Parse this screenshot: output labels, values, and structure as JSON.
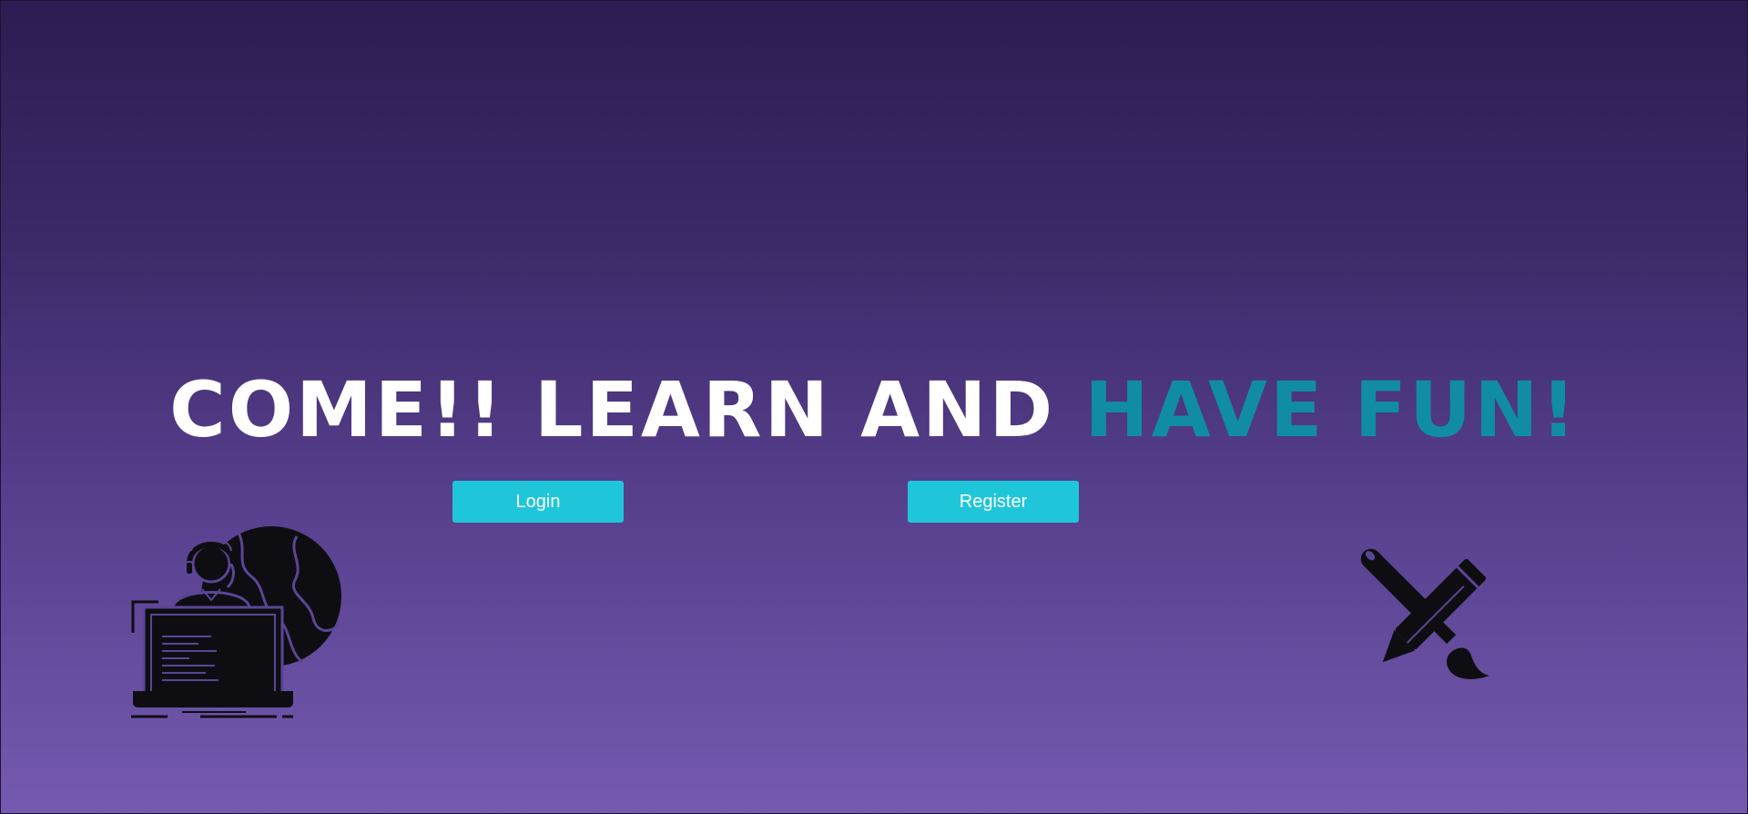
{
  "hero": {
    "title_white": "COME!! LEARN AND ",
    "title_accent": "HAVE FUN!"
  },
  "actions": {
    "login_label": "Login",
    "register_label": "Register"
  },
  "icons": {
    "left": "online-teacher-laptop-globe-icon",
    "right": "pencil-paintbrush-crossed-icon"
  },
  "colors": {
    "gradient_top": "#2c1c52",
    "gradient_bottom": "#755aaf",
    "accent_text": "#118ca5",
    "button_bg": "#1fc6d9",
    "button_text": "#ffffff",
    "icon_fill": "#0e0e12"
  }
}
